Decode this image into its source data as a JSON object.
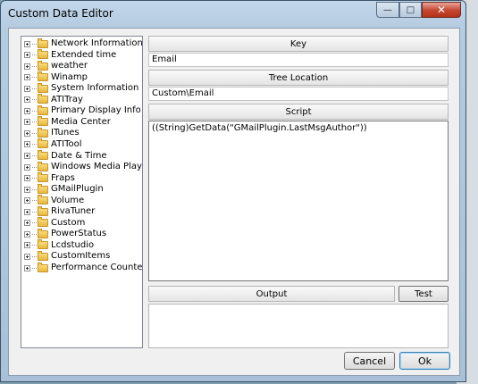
{
  "window": {
    "title": "Custom Data Editor",
    "minimize_glyph": "—",
    "maximize_glyph": "□",
    "close_glyph": "✕"
  },
  "tree": {
    "items": [
      {
        "label": "Network Information"
      },
      {
        "label": "Extended time"
      },
      {
        "label": "weather"
      },
      {
        "label": "Winamp"
      },
      {
        "label": "System Information"
      },
      {
        "label": "ATITray"
      },
      {
        "label": "Primary Display Info"
      },
      {
        "label": "Media Center"
      },
      {
        "label": "ITunes"
      },
      {
        "label": "ATITool"
      },
      {
        "label": "Date & Time"
      },
      {
        "label": "Windows Media Player"
      },
      {
        "label": "Fraps"
      },
      {
        "label": "GMailPlugin"
      },
      {
        "label": "Volume"
      },
      {
        "label": "RivaTuner"
      },
      {
        "label": "Custom"
      },
      {
        "label": "PowerStatus"
      },
      {
        "label": "Lcdstudio"
      },
      {
        "label": "CustomItems"
      },
      {
        "label": "Performance Counters"
      }
    ]
  },
  "key": {
    "header": "Key",
    "value": "Email"
  },
  "tree_location": {
    "header": "Tree Location",
    "value": "Custom\\Email"
  },
  "script": {
    "header": "Script",
    "value": "((String)GetData(\"GMailPlugin.LastMsgAuthor\"))"
  },
  "output": {
    "header": "Output",
    "test_label": "Test"
  },
  "buttons": {
    "cancel": "Cancel",
    "ok": "Ok"
  }
}
